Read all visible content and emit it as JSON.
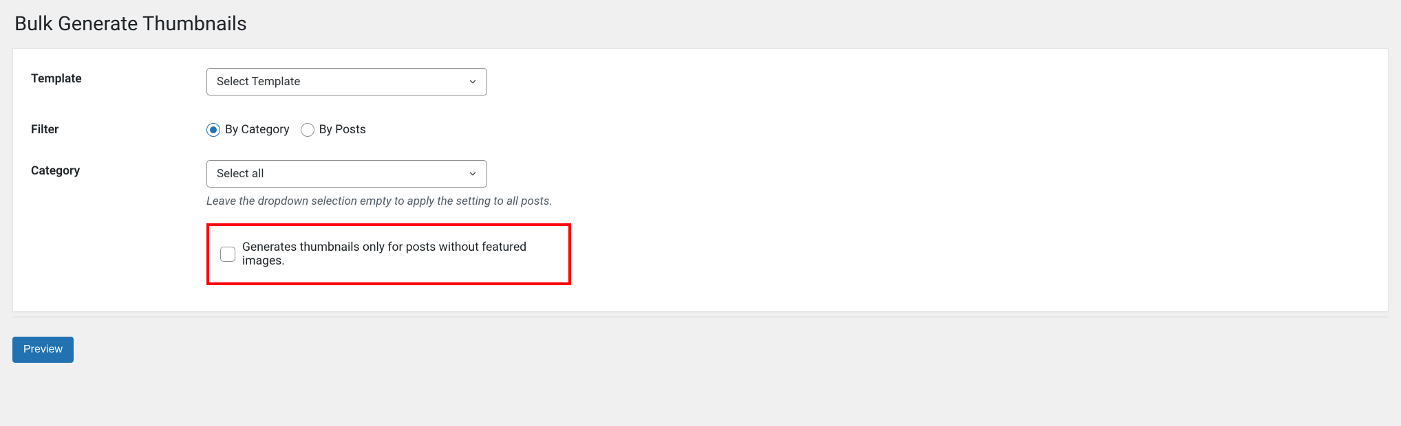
{
  "page": {
    "title": "Bulk Generate Thumbnails"
  },
  "form": {
    "template": {
      "label": "Template",
      "selected": "Select Template"
    },
    "filter": {
      "label": "Filter",
      "options": [
        {
          "label": "By Category",
          "checked": true
        },
        {
          "label": "By Posts",
          "checked": false
        }
      ]
    },
    "category": {
      "label": "Category",
      "selected": "Select all",
      "hint": "Leave the dropdown selection empty to apply the setting to all posts."
    },
    "only_without_featured": {
      "label": "Generates thumbnails only for posts without featured images.",
      "checked": false
    }
  },
  "buttons": {
    "preview": "Preview"
  }
}
